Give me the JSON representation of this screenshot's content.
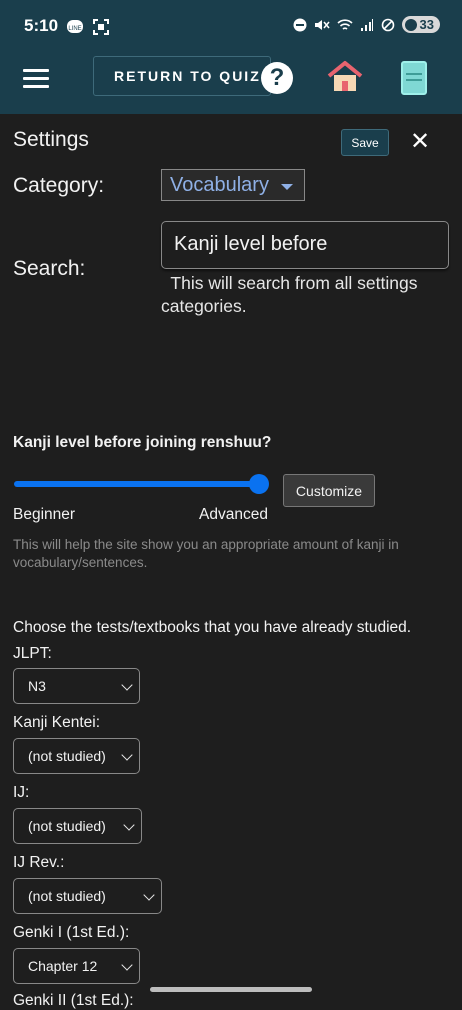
{
  "status_bar": {
    "time": "5:10",
    "battery": "33"
  },
  "header": {
    "return_label": "RETURN TO QUIZ",
    "icons": [
      "menu-icon",
      "help-icon",
      "home-icon",
      "book-icon"
    ]
  },
  "settings": {
    "title": "Settings",
    "save_label": "Save",
    "close_label": "✕",
    "category_label": "Category:",
    "category_value": "Vocabulary",
    "search_label": "Search:",
    "search_value": "Kanji level before",
    "search_help": "This will search from all settings categories."
  },
  "kanji_level": {
    "question": "Kanji level before joining renshuu?",
    "slider_value_fraction": 1.0,
    "customize_label": "Customize",
    "min_label": "Beginner",
    "max_label": "Advanced",
    "help": "This will help the site show you an appropriate amount of kanji in vocabulary/sentences."
  },
  "tests": {
    "intro": "Choose the tests/textbooks that you have already studied.",
    "fields": [
      {
        "label": "JLPT:",
        "value": "N3"
      },
      {
        "label": "Kanji Kentei:",
        "value": "(not studied)"
      },
      {
        "label": "IJ:",
        "value": "(not studied)"
      },
      {
        "label": "IJ Rev.:",
        "value": "(not studied)"
      },
      {
        "label": "Genki I (1st Ed.):",
        "value": "Chapter 12"
      }
    ],
    "next_label_partial": "Genki II (1st Ed.):"
  },
  "colors": {
    "header_bg": "#1a3e4c",
    "page_bg": "#1e1e1e",
    "slider": "#0a72f0",
    "link_blue": "#8fb0e6"
  }
}
